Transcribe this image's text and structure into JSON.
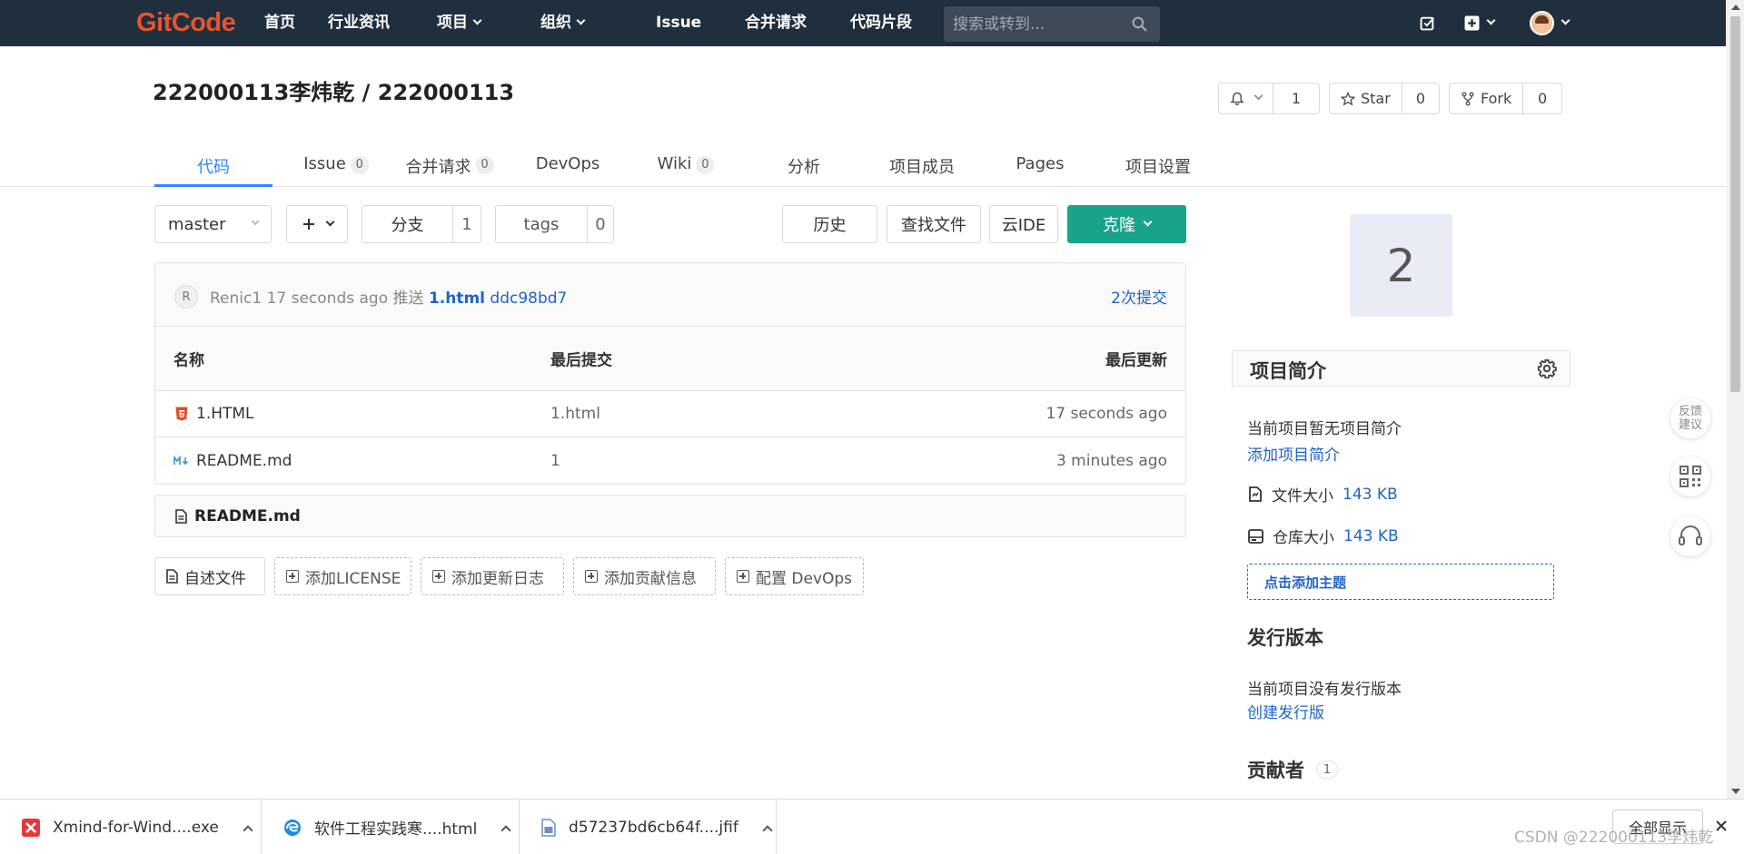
{
  "nav": {
    "logo": "GitCode",
    "items": [
      {
        "label": "首页"
      },
      {
        "label": "行业资讯"
      },
      {
        "label": "项目"
      },
      {
        "label": "组织"
      },
      {
        "label": "Issue"
      },
      {
        "label": "合并请求"
      },
      {
        "label": "代码片段"
      }
    ],
    "search_placeholder": "搜索或转到..."
  },
  "project": {
    "title": "222000113李炜乾 / 222000113",
    "watch_count": "1",
    "star_label": "Star",
    "star_count": "0",
    "fork_label": "Fork",
    "fork_count": "0"
  },
  "tabs": [
    {
      "label": "代码",
      "badge": ""
    },
    {
      "label": "Issue",
      "badge": "0"
    },
    {
      "label": "合并请求",
      "badge": "0"
    },
    {
      "label": "DevOps",
      "badge": ""
    },
    {
      "label": "Wiki",
      "badge": "0"
    },
    {
      "label": "分析",
      "badge": ""
    },
    {
      "label": "项目成员",
      "badge": ""
    },
    {
      "label": "Pages",
      "badge": ""
    },
    {
      "label": "项目设置",
      "badge": ""
    }
  ],
  "toolbar": {
    "branch": "master",
    "branches_label": "分支",
    "branches_count": "1",
    "tags_label": "tags",
    "tags_count": "0",
    "history": "历史",
    "find_file": "查找文件",
    "cloud_ide": "云IDE",
    "clone": "克隆"
  },
  "commit": {
    "avatar_letter": "R",
    "author": "Renic1",
    "time": "17 seconds ago",
    "action": "推送",
    "file": "1.html",
    "hash": "ddc98bd7",
    "count_label": "2次提交"
  },
  "file_table": {
    "headers": {
      "name": "名称",
      "last_commit": "最后提交",
      "last_update": "最后更新"
    },
    "rows": [
      {
        "name": "1.HTML",
        "commit": "1.html",
        "updated": "17 seconds ago"
      },
      {
        "name": "README.md",
        "commit": "1",
        "updated": "3 minutes ago"
      }
    ]
  },
  "readme": {
    "title": "README.md"
  },
  "actions": [
    {
      "label": "自述文件"
    },
    {
      "label": "添加LICENSE"
    },
    {
      "label": "添加更新日志"
    },
    {
      "label": "添加贡献信息"
    },
    {
      "label": "配置 DevOps"
    }
  ],
  "sidebar": {
    "avatar_char": "2",
    "intro_title": "项目简介",
    "no_intro": "当前项目暂无项目简介",
    "add_intro": "添加项目简介",
    "file_size_label": "文件大小",
    "file_size": "143 KB",
    "repo_size_label": "仓库大小",
    "repo_size": "143 KB",
    "add_topic": "点击添加主题",
    "release_title": "发行版本",
    "no_release": "当前项目没有发行版本",
    "create_release": "创建发行版",
    "contributors_title": "贡献者",
    "contributors_count": "1"
  },
  "float": {
    "feedback": "反馈\n建议"
  },
  "downloads": {
    "items": [
      {
        "name": "Xmind-for-Wind....exe"
      },
      {
        "name": "软件工程实践寒....html"
      },
      {
        "name": "d57237bd6cb64f....jfif"
      }
    ],
    "show_all": "全部显示"
  },
  "watermark": "CSDN @222000113李炜乾",
  "colors": {
    "nav_bg": "#202f3d",
    "logo": "#e8532f",
    "accent": "#3385ff",
    "clone": "#1aa38b",
    "link": "#1f64c7"
  }
}
